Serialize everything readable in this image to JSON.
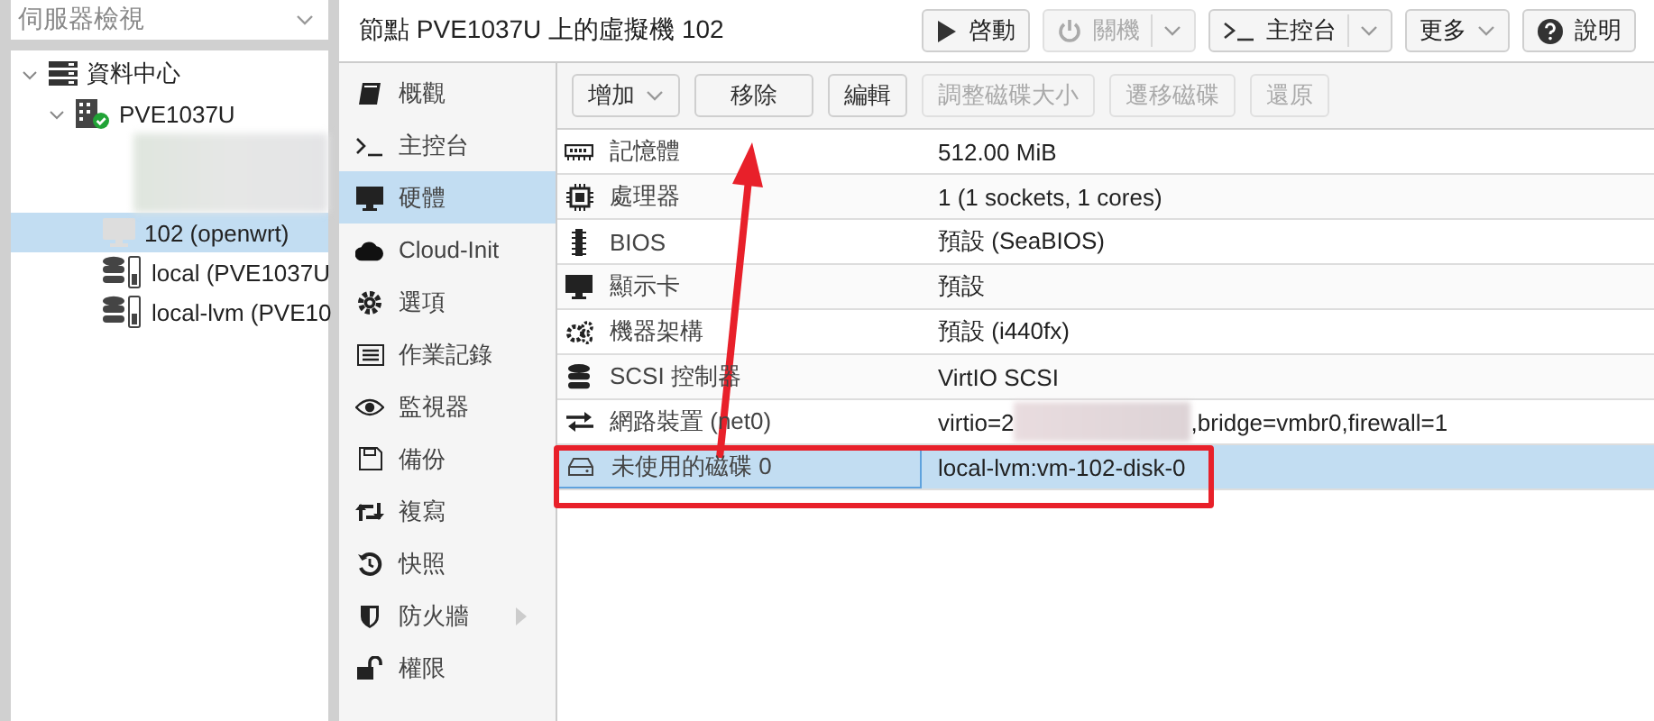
{
  "tree_header": {
    "label": "伺服器檢視"
  },
  "tree": [
    {
      "kind": "datacenter",
      "label": "資料中心",
      "expanded": true,
      "selected": false,
      "children": [
        {
          "kind": "node",
          "label": "PVE1037U",
          "expanded": true,
          "selected": false,
          "children": [
            {
              "kind": "redacted"
            },
            {
              "kind": "vm",
              "label": "102 (openwrt)",
              "selected": true
            },
            {
              "kind": "storage",
              "label": "local (PVE1037U",
              "selected": false
            },
            {
              "kind": "storage",
              "label": "local-lvm (PVE10",
              "selected": false
            }
          ]
        }
      ]
    }
  ],
  "title": "節點 PVE1037U 上的虛擬機 102",
  "header_buttons": [
    {
      "kind": "plain",
      "label": "啓動",
      "disabled": false
    },
    {
      "kind": "split",
      "label": "關機",
      "disabled": true
    },
    {
      "kind": "split",
      "label": "主控台",
      "disabled": false
    },
    {
      "kind": "menu",
      "label": "更多",
      "disabled": false
    },
    {
      "kind": "plain",
      "label": "說明",
      "disabled": false
    }
  ],
  "menu": [
    {
      "label": "概觀",
      "selected": false
    },
    {
      "label": "主控台",
      "selected": false
    },
    {
      "label": "硬體",
      "selected": true
    },
    {
      "label": "Cloud-Init",
      "selected": false
    },
    {
      "label": "選項",
      "selected": false
    },
    {
      "label": "作業記錄",
      "selected": false
    },
    {
      "label": "監視器",
      "selected": false
    },
    {
      "label": "備份",
      "selected": false
    },
    {
      "label": "複寫",
      "selected": false
    },
    {
      "label": "快照",
      "selected": false
    },
    {
      "label": "防火牆",
      "selected": false,
      "submenu": true
    },
    {
      "label": "權限",
      "selected": false
    }
  ],
  "toolbar": [
    {
      "kind": "menu",
      "label": "增加",
      "disabled": false
    },
    {
      "kind": "wide",
      "label": "移除",
      "disabled": false,
      "arrow_annotation": true
    },
    {
      "kind": "plain",
      "label": "編輯",
      "disabled": false
    },
    {
      "kind": "plain",
      "label": "調整磁碟大小",
      "disabled": true
    },
    {
      "kind": "plain",
      "label": "遷移磁碟",
      "disabled": true
    },
    {
      "kind": "plain",
      "label": "還原",
      "disabled": true
    }
  ],
  "rows": [
    {
      "name": "記憶體",
      "value_parts": [
        "512.00 MiB"
      ],
      "selected": false
    },
    {
      "name": "處理器",
      "value_parts": [
        "1 (1 sockets, 1 cores)"
      ],
      "selected": false
    },
    {
      "name": "BIOS",
      "value_parts": [
        "預設 (SeaBIOS)"
      ],
      "selected": false
    },
    {
      "name": "顯示卡",
      "value_parts": [
        "預設"
      ],
      "selected": false
    },
    {
      "name": "機器架構",
      "value_parts": [
        "預設 (i440fx)"
      ],
      "selected": false
    },
    {
      "name": "SCSI 控制器",
      "value_parts": [
        "VirtIO SCSI"
      ],
      "selected": false
    },
    {
      "name": "網路裝置 (net0)",
      "value_parts": [
        "virtio=2",
        ",bridge=vmbr0,firewall=1"
      ],
      "selected": false
    },
    {
      "name": "未使用的磁碟 0",
      "value_parts": [
        "local-lvm:vm-102-disk-0"
      ],
      "selected": true,
      "box_annotation": true
    }
  ]
}
